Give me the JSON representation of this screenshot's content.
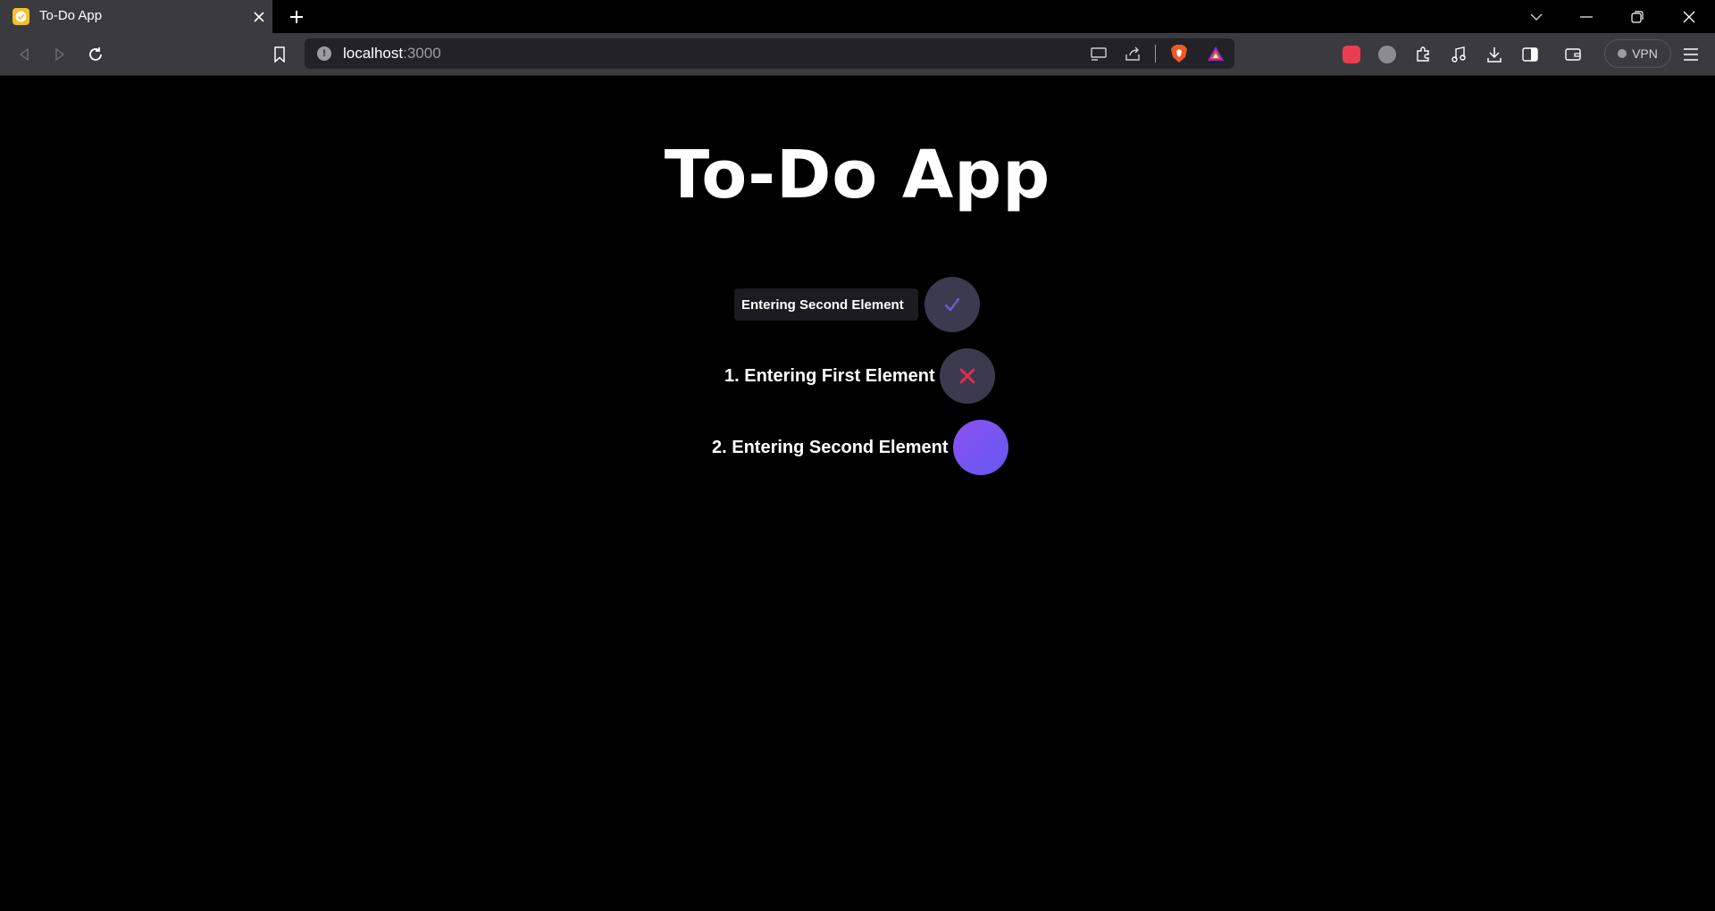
{
  "browser": {
    "tab": {
      "title": "To-Do App",
      "favicon": "checkmark-favicon-icon",
      "favicon_color": "#f5c02b"
    },
    "url": {
      "host": "localhost",
      "port": ":3000"
    },
    "vpn_label": "VPN"
  },
  "app": {
    "title": "To-Do App",
    "input": {
      "value": "Entering Second Element"
    },
    "items": [
      {
        "label": "1. Entering First Element",
        "action_icon": "close-icon"
      },
      {
        "label": "2. Entering Second Element",
        "action_icon": "none"
      }
    ],
    "colors": {
      "background": "#000000",
      "button_bg": "#3b3a4f",
      "check_color": "#6b5ac9",
      "delete_color": "#e8294f",
      "gradient_start": "#8c52f0",
      "gradient_end": "#6457f2"
    }
  }
}
